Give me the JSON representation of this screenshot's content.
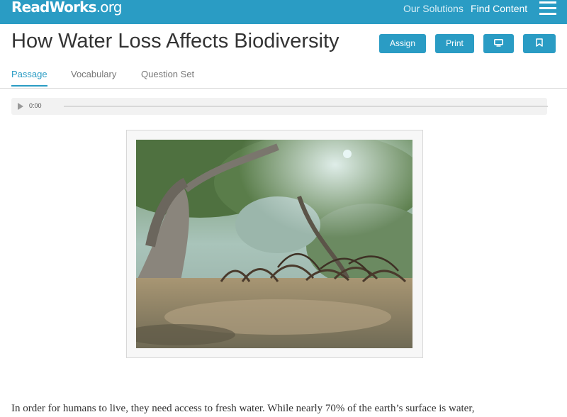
{
  "header": {
    "logo_main": "ReadWorks",
    "logo_suffix": ".org",
    "nav": {
      "solutions": "Our Solutions",
      "find_content": "Find Content"
    },
    "menu_icon": "hamburger-menu-icon",
    "accent_color": "#2a9cc4"
  },
  "article": {
    "title": "How Water Loss Affects Biodiversity",
    "actions": {
      "assign": "Assign",
      "print": "Print",
      "present_icon": "monitor-icon",
      "bookmark_icon": "bookmark-icon"
    },
    "tabs": [
      {
        "label": "Passage",
        "active": true
      },
      {
        "label": "Vocabulary",
        "active": false
      },
      {
        "label": "Question Set",
        "active": false
      }
    ]
  },
  "audio": {
    "time": "0:00",
    "play_icon": "play-icon"
  },
  "passage": {
    "first_line": "In order for humans to live, they need access to fresh water. While nearly 70% of the earth’s surface is water,"
  }
}
